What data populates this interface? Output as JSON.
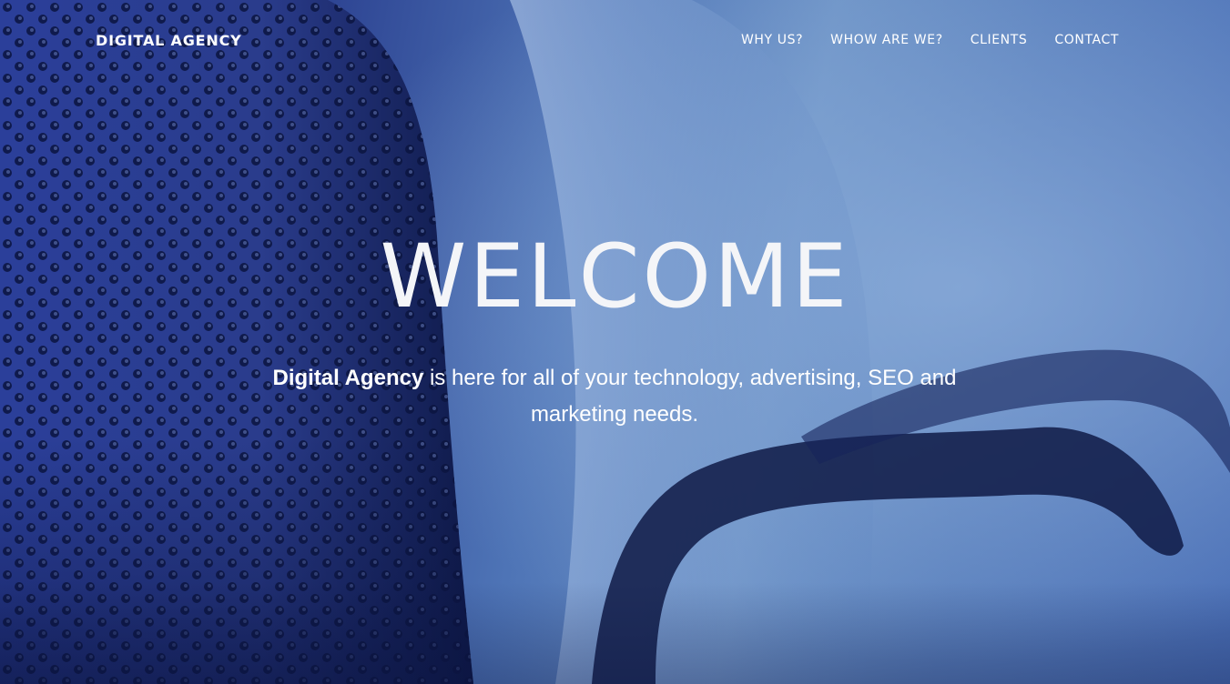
{
  "nav": {
    "brand": "DIGITAL AGENCY",
    "links": [
      {
        "label": "WHY US?"
      },
      {
        "label": "WHOW ARE WE?"
      },
      {
        "label": "CLIENTS"
      },
      {
        "label": "CONTACT"
      }
    ]
  },
  "hero": {
    "heading": "WELCOME",
    "tagline_strong": "Digital Agency",
    "tagline_rest": " is here for all of your technology, advertising, SEO and marketing needs.",
    "background_description_colors": {
      "dark_blue": "#1a2a6b",
      "mid_blue": "#4e74b6",
      "light_blue": "#6d93c6"
    }
  }
}
